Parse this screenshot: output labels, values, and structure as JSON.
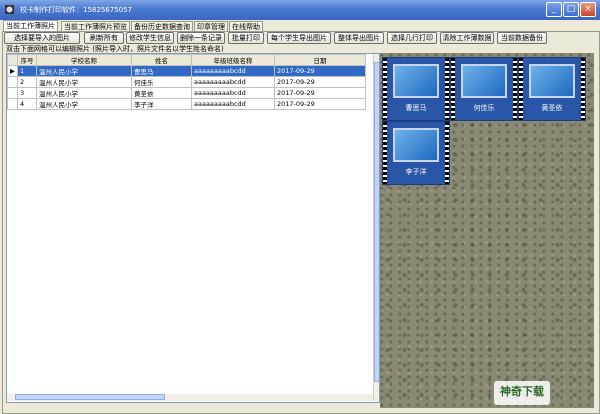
{
  "window": {
    "title": "校卡制作打印软件：15825675057",
    "minimize_icon": "minimize-icon",
    "maximize_icon": "maximize-icon",
    "close_icon": "close-icon"
  },
  "tabs": [
    {
      "label": "当前工作薄照片"
    },
    {
      "label": "当前工作薄照片预览"
    },
    {
      "label": "备份历史数据查询"
    },
    {
      "label": "印章管理"
    },
    {
      "label": "在线帮助"
    }
  ],
  "toolbar": [
    {
      "label": "选择要导入的图片"
    },
    {
      "label": "刷新所有"
    },
    {
      "label": "修改学生信息"
    },
    {
      "label": "删除一条记录"
    },
    {
      "label": "批量打印"
    },
    {
      "label": "每个学生导出图片"
    },
    {
      "label": "整体导出图片"
    },
    {
      "label": "选择几行打印"
    },
    {
      "label": "清除工作薄数据"
    },
    {
      "label": "当前数据备份"
    }
  ],
  "hint": "双击下面网格可以编辑照片 (照片导入时，照片文件名以学生姓名命名)",
  "grid": {
    "columns": [
      "序号",
      "学校名称",
      "姓名",
      "年级班级名称",
      "日期"
    ],
    "rows": [
      {
        "no": "1",
        "school": "温州人民小学",
        "name": "曹思马",
        "class": "aaaaaaaaabcdd",
        "date": "2017-09-29"
      },
      {
        "no": "2",
        "school": "温州人民小学",
        "name": "何佳乐",
        "class": "aaaaaaaaabcdd",
        "date": "2017-09-29"
      },
      {
        "no": "3",
        "school": "温州人民小学",
        "name": "黄圣依",
        "class": "aaaaaaaaabcdd",
        "date": "2017-09-29"
      },
      {
        "no": "4",
        "school": "温州人民小学",
        "name": "李子洋",
        "class": "aaaaaaaaabcdd",
        "date": "2017-09-29"
      }
    ]
  },
  "photos": [
    {
      "caption": "曹思马"
    },
    {
      "caption": "何佳乐"
    },
    {
      "caption": "黄圣依"
    },
    {
      "caption": "李子洋"
    }
  ],
  "watermark": "神奇下载"
}
